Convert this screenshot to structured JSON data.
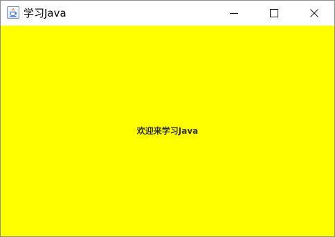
{
  "window": {
    "title": "学习Java"
  },
  "content": {
    "message": "欢迎来学习Java",
    "background_color": "#ffff00"
  },
  "icons": {
    "app": "java-cup-icon",
    "minimize": "minimize-icon",
    "maximize": "maximize-icon",
    "close": "close-icon"
  }
}
